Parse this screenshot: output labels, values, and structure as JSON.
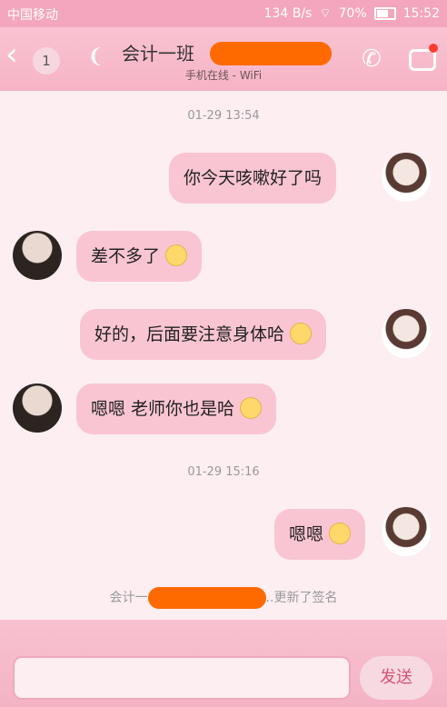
{
  "status_bar": {
    "carrier": "中国移动",
    "speed": "134 B/s",
    "battery": "70%",
    "time": "15:52"
  },
  "header": {
    "back_icon": "chevron-left-icon",
    "unread_count": "1",
    "ear_icon": "ear-icon",
    "title": "会计一班",
    "subtitle": "手机在线 - WiFi",
    "phone_icon": "phone-icon",
    "more_icon": "chat-settings-icon"
  },
  "chat": {
    "timestamps": [
      "01-29 13:54",
      "01-29 15:16"
    ],
    "messages": [
      {
        "side": "right",
        "text": "你今天咳嗽好了吗"
      },
      {
        "side": "left",
        "text": "差不多了"
      },
      {
        "side": "right",
        "text": "好的，后面要注意身体哈"
      },
      {
        "side": "left",
        "text": "嗯嗯 老师你也是哈"
      },
      {
        "side": "right",
        "text": "嗯嗯"
      }
    ],
    "system_notice_prefix": "会计一",
    "system_notice_suffix": "..更新了签名"
  },
  "input_area": {
    "placeholder": "",
    "send_label": "发送"
  },
  "colors": {
    "bubble": "#f9c5d2",
    "header": "#f6b4c6",
    "redaction": "#ff6a00"
  }
}
